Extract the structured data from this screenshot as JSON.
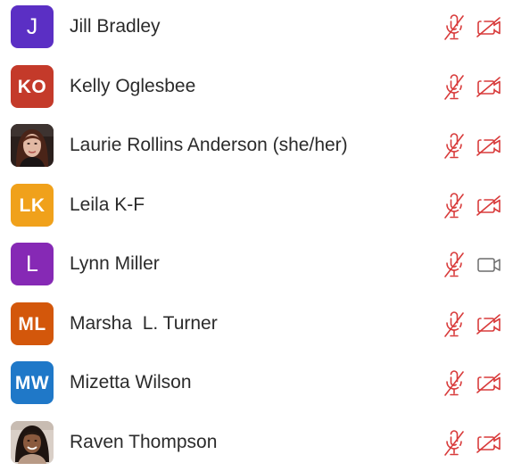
{
  "colors": {
    "muted_red": "#d83b3b",
    "camera_on_gray": "#6b6b6b",
    "avatar_purple_dark": "#5b2fc4",
    "avatar_red": "#c43a2a",
    "avatar_orange": "#f0a11b",
    "avatar_purple": "#8629b5",
    "avatar_burnt_orange": "#d3570b",
    "avatar_blue": "#1f78c8"
  },
  "participants": [
    {
      "name": "Jill Bradley",
      "initials": "J",
      "avatar_color": "#5b2fc4",
      "mic_icon": "mic-muted-icon",
      "camera_icon": "camera-off-icon"
    },
    {
      "name": "Kelly Oglesbee",
      "initials": "KO",
      "avatar_color": "#c43a2a",
      "mic_icon": "mic-muted-icon",
      "camera_icon": "camera-off-icon"
    },
    {
      "name": "Laurie Rollins Anderson (she/her)",
      "initials": "",
      "avatar_color": "",
      "mic_icon": "mic-muted-icon",
      "camera_icon": "camera-off-icon"
    },
    {
      "name": "Leila K-F",
      "initials": "LK",
      "avatar_color": "#f0a11b",
      "mic_icon": "mic-muted-icon",
      "camera_icon": "camera-off-icon"
    },
    {
      "name": "Lynn Miller",
      "initials": "L",
      "avatar_color": "#8629b5",
      "mic_icon": "mic-muted-icon",
      "camera_icon": "camera-on-icon"
    },
    {
      "name": "Marsha  L. Turner",
      "initials": "ML",
      "avatar_color": "#d3570b",
      "mic_icon": "mic-muted-icon",
      "camera_icon": "camera-off-icon"
    },
    {
      "name": "Mizetta Wilson",
      "initials": "MW",
      "avatar_color": "#1f78c8",
      "mic_icon": "mic-muted-icon",
      "camera_icon": "camera-off-icon"
    },
    {
      "name": "Raven Thompson",
      "initials": "",
      "avatar_color": "",
      "mic_icon": "mic-muted-icon",
      "camera_icon": "camera-off-icon"
    }
  ]
}
